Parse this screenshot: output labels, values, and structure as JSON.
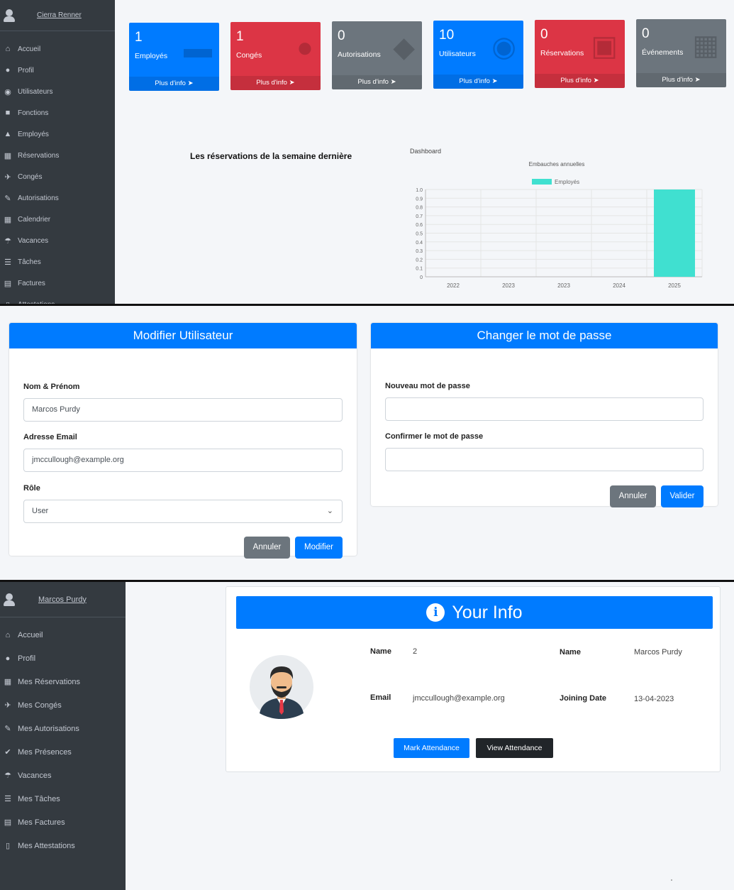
{
  "admin_panel": {
    "sidebar": {
      "username": "Cierra Renner",
      "items": [
        {
          "label": "Accueil",
          "icon": "home-icon"
        },
        {
          "label": "Profil",
          "icon": "user-icon"
        },
        {
          "label": "Utilisateurs",
          "icon": "users-icon"
        },
        {
          "label": "Fonctions",
          "icon": "briefcase-icon"
        },
        {
          "label": "Employés",
          "icon": "user-tie-icon"
        },
        {
          "label": "Réservations",
          "icon": "calendar-icon"
        },
        {
          "label": "Congés",
          "icon": "plane-icon"
        },
        {
          "label": "Autorisations",
          "icon": "signature-icon"
        },
        {
          "label": "Calendrier",
          "icon": "calendar-icon"
        },
        {
          "label": "Vacances",
          "icon": "umbrella-beach-icon"
        },
        {
          "label": "Tâches",
          "icon": "tasks-icon"
        },
        {
          "label": "Factures",
          "icon": "file-invoice-icon"
        },
        {
          "label": "Attestations",
          "icon": "file-icon"
        }
      ]
    },
    "stat_boxes": [
      {
        "count": "1",
        "label": "Employés",
        "more": "Plus d'info",
        "color": "#007bff",
        "icon": "car-icon"
      },
      {
        "count": "1",
        "label": "Congés",
        "more": "Plus d'info",
        "color": "#dc3545",
        "icon": "user-icon"
      },
      {
        "count": "0",
        "label": "Autorisations",
        "more": "Plus d'info",
        "color": "#6c757d",
        "icon": "handshake-icon"
      },
      {
        "count": "10",
        "label": "Utilisateurs",
        "more": "Plus d'info",
        "color": "#007bff",
        "icon": "users-icon"
      },
      {
        "count": "0",
        "label": "Réservations",
        "more": "Plus d'info",
        "color": "#dc3545",
        "icon": "calendar-check-icon"
      },
      {
        "count": "0",
        "label": "Événements",
        "more": "Plus d'info",
        "color": "#6c757d",
        "icon": "calendar-icon"
      }
    ],
    "reservations_title": "Les réservations de la semaine dernière",
    "chart_caption": "Dashboard"
  },
  "chart_data": {
    "type": "bar",
    "title": "Embauches annuelles",
    "categories": [
      "2022",
      "2023",
      "2023",
      "2024",
      "2025"
    ],
    "series": [
      {
        "name": "Employés",
        "values": [
          0,
          0,
          0,
          0,
          1
        ],
        "color": "#40e0d0"
      }
    ],
    "yticks": [
      "0",
      "0.1",
      "0.2",
      "0.3",
      "0.4",
      "0.5",
      "0.6",
      "0.7",
      "0.8",
      "0.9",
      "1.0"
    ],
    "ylim": [
      0,
      1
    ],
    "grid": true,
    "legend": "top"
  },
  "edit_user": {
    "title": "Modifier Utilisateur",
    "name_label": "Nom & Prénom",
    "name_value": "Marcos Purdy",
    "email_label": "Adresse Email",
    "email_value": "jmccullough@example.org",
    "role_label": "Rôle",
    "role_value": "User",
    "cancel": "Annuler",
    "submit": "Modifier"
  },
  "change_password": {
    "title": "Changer le mot de passe",
    "new_label": "Nouveau mot de passe",
    "confirm_label": "Confirmer le mot de passe",
    "cancel": "Annuler",
    "submit": "Valider"
  },
  "user_panel": {
    "sidebar": {
      "username": "Marcos Purdy",
      "items": [
        {
          "label": "Accueil",
          "icon": "home-icon"
        },
        {
          "label": "Profil",
          "icon": "user-icon"
        },
        {
          "label": "Mes Réservations",
          "icon": "calendar-icon"
        },
        {
          "label": "Mes Congés",
          "icon": "plane-icon"
        },
        {
          "label": "Mes Autorisations",
          "icon": "signature-icon"
        },
        {
          "label": "Mes Présences",
          "icon": "user-check-icon"
        },
        {
          "label": "Vacances",
          "icon": "umbrella-beach-icon"
        },
        {
          "label": "Mes Tâches",
          "icon": "tasks-icon"
        },
        {
          "label": "Mes Factures",
          "icon": "file-invoice-icon"
        },
        {
          "label": "Mes Attestations",
          "icon": "file-icon"
        }
      ]
    },
    "info": {
      "title": "Your Info",
      "name_label": "Name",
      "name_value": "2",
      "name2_label": "Name",
      "name2_value": "Marcos Purdy",
      "email_label": "Email",
      "email_value": "jmccullough@example.org",
      "joining_label": "Joining Date",
      "joining_value": "13-04-2023",
      "mark": "Mark Attendance",
      "view": "View Attendance"
    }
  }
}
